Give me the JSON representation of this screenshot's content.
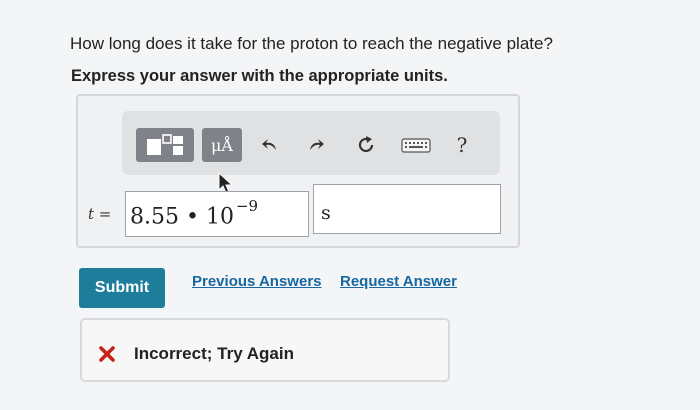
{
  "question": {
    "text": "How long does it take for the proton to reach the negative plate?",
    "instruction": "Express your answer with the appropriate units."
  },
  "toolbar": {
    "templates_icon": "templates-icon",
    "units_label": "μÅ",
    "undo_icon": "undo-icon",
    "redo_icon": "redo-icon",
    "reset_icon": "reset-icon",
    "keyboard_icon": "keyboard-icon",
    "help_label": "?"
  },
  "answer": {
    "variable": "t =",
    "value_mantissa": "8.55",
    "operator": "•",
    "base": "10",
    "exponent": "−9",
    "unit": "s"
  },
  "actions": {
    "submit_label": "Submit",
    "previous_answers_label": "Previous Answers",
    "request_answer_label": "Request Answer"
  },
  "feedback": {
    "text": "Incorrect; Try Again",
    "icon": "x-icon",
    "color": "#c4231b"
  },
  "colors": {
    "submit": "#1f7d9c",
    "link": "#1768a0",
    "toolbar_button": "#7f8389"
  }
}
